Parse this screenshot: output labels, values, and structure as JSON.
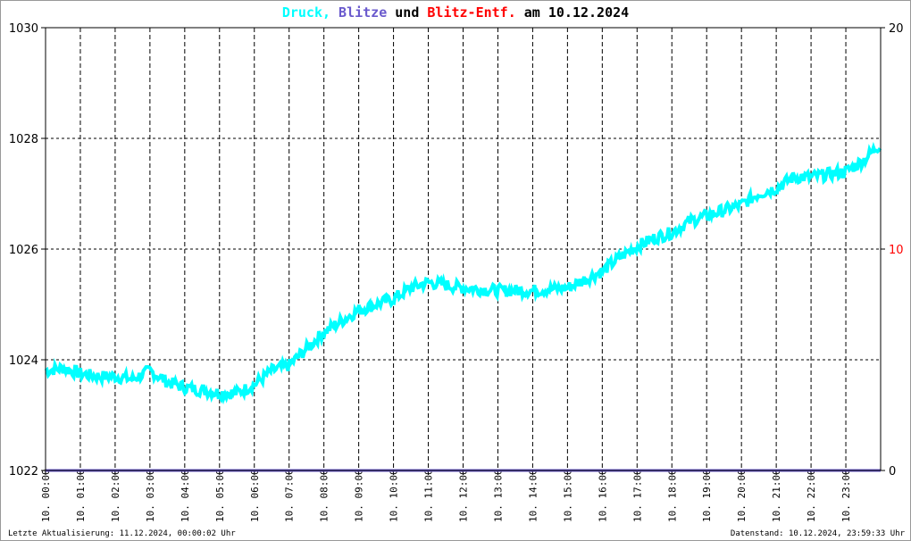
{
  "chart_data": {
    "type": "line",
    "title_parts": [
      {
        "text": "Druck,",
        "color": "#00ffff"
      },
      {
        "text": "Blitze",
        "color": "#6a5acd"
      },
      {
        "text": "und",
        "color": "#000000"
      },
      {
        "text": "Blitz-Entf.",
        "color": "#ff0000"
      },
      {
        "text": "am 10.12.2024",
        "color": "#000000"
      }
    ],
    "ylim": [
      1022,
      1030
    ],
    "yticks": [
      "1022",
      "1024",
      "1026",
      "1028",
      "1030"
    ],
    "y2lim": [
      0,
      20
    ],
    "y2ticks": [
      {
        "label": "0",
        "color": "#000000"
      },
      {
        "label": "10",
        "color": "#ff0000"
      },
      {
        "label": "20",
        "color": "#000000"
      }
    ],
    "xticks": [
      "10. 00:00",
      "10. 01:00",
      "10. 02:00",
      "10. 03:00",
      "10. 04:00",
      "10. 05:00",
      "10. 06:00",
      "10. 07:00",
      "10. 08:00",
      "10. 09:00",
      "10. 10:00",
      "10. 11:00",
      "10. 12:00",
      "10. 13:00",
      "10. 14:00",
      "10. 15:00",
      "10. 16:00",
      "10. 17:00",
      "10. 18:00",
      "10. 19:00",
      "10. 20:00",
      "10. 21:00",
      "10. 22:00",
      "10. 23:00"
    ],
    "grid": true,
    "series": [
      {
        "name": "Druck",
        "color": "#00ffff",
        "x_hours": [
          0,
          0.5,
          1,
          1.5,
          2,
          2.5,
          3,
          3.5,
          4,
          4.5,
          5,
          5.5,
          6,
          6.5,
          7,
          7.5,
          8,
          8.5,
          9,
          9.5,
          10,
          10.5,
          11,
          11.5,
          12,
          13,
          14,
          15,
          15.5,
          16,
          16.5,
          17,
          17.5,
          18,
          18.5,
          19,
          19.5,
          20,
          20.5,
          21,
          21.5,
          22,
          22.5,
          23,
          23.5,
          24
        ],
        "values": [
          1023.8,
          1023.85,
          1023.75,
          1023.7,
          1023.7,
          1023.65,
          1023.8,
          1023.6,
          1023.5,
          1023.45,
          1023.4,
          1023.4,
          1023.55,
          1023.8,
          1023.9,
          1024.2,
          1024.5,
          1024.7,
          1024.9,
          1025.0,
          1025.1,
          1025.3,
          1025.4,
          1025.35,
          1025.3,
          1025.25,
          1025.25,
          1025.3,
          1025.45,
          1025.6,
          1025.85,
          1026.05,
          1026.2,
          1026.3,
          1026.5,
          1026.6,
          1026.7,
          1026.8,
          1027.0,
          1027.1,
          1027.3,
          1027.3,
          1027.35,
          1027.4,
          1027.6,
          1027.9
        ]
      },
      {
        "name": "Blitze",
        "color": "#6a5acd",
        "x_hours": [
          0,
          24
        ],
        "values": [
          0,
          0
        ]
      }
    ]
  },
  "footer": {
    "left": "Letzte Aktualisierung: 11.12.2024, 00:00:02 Uhr",
    "right": "Datenstand: 10.12.2024, 23:59:33 Uhr"
  }
}
